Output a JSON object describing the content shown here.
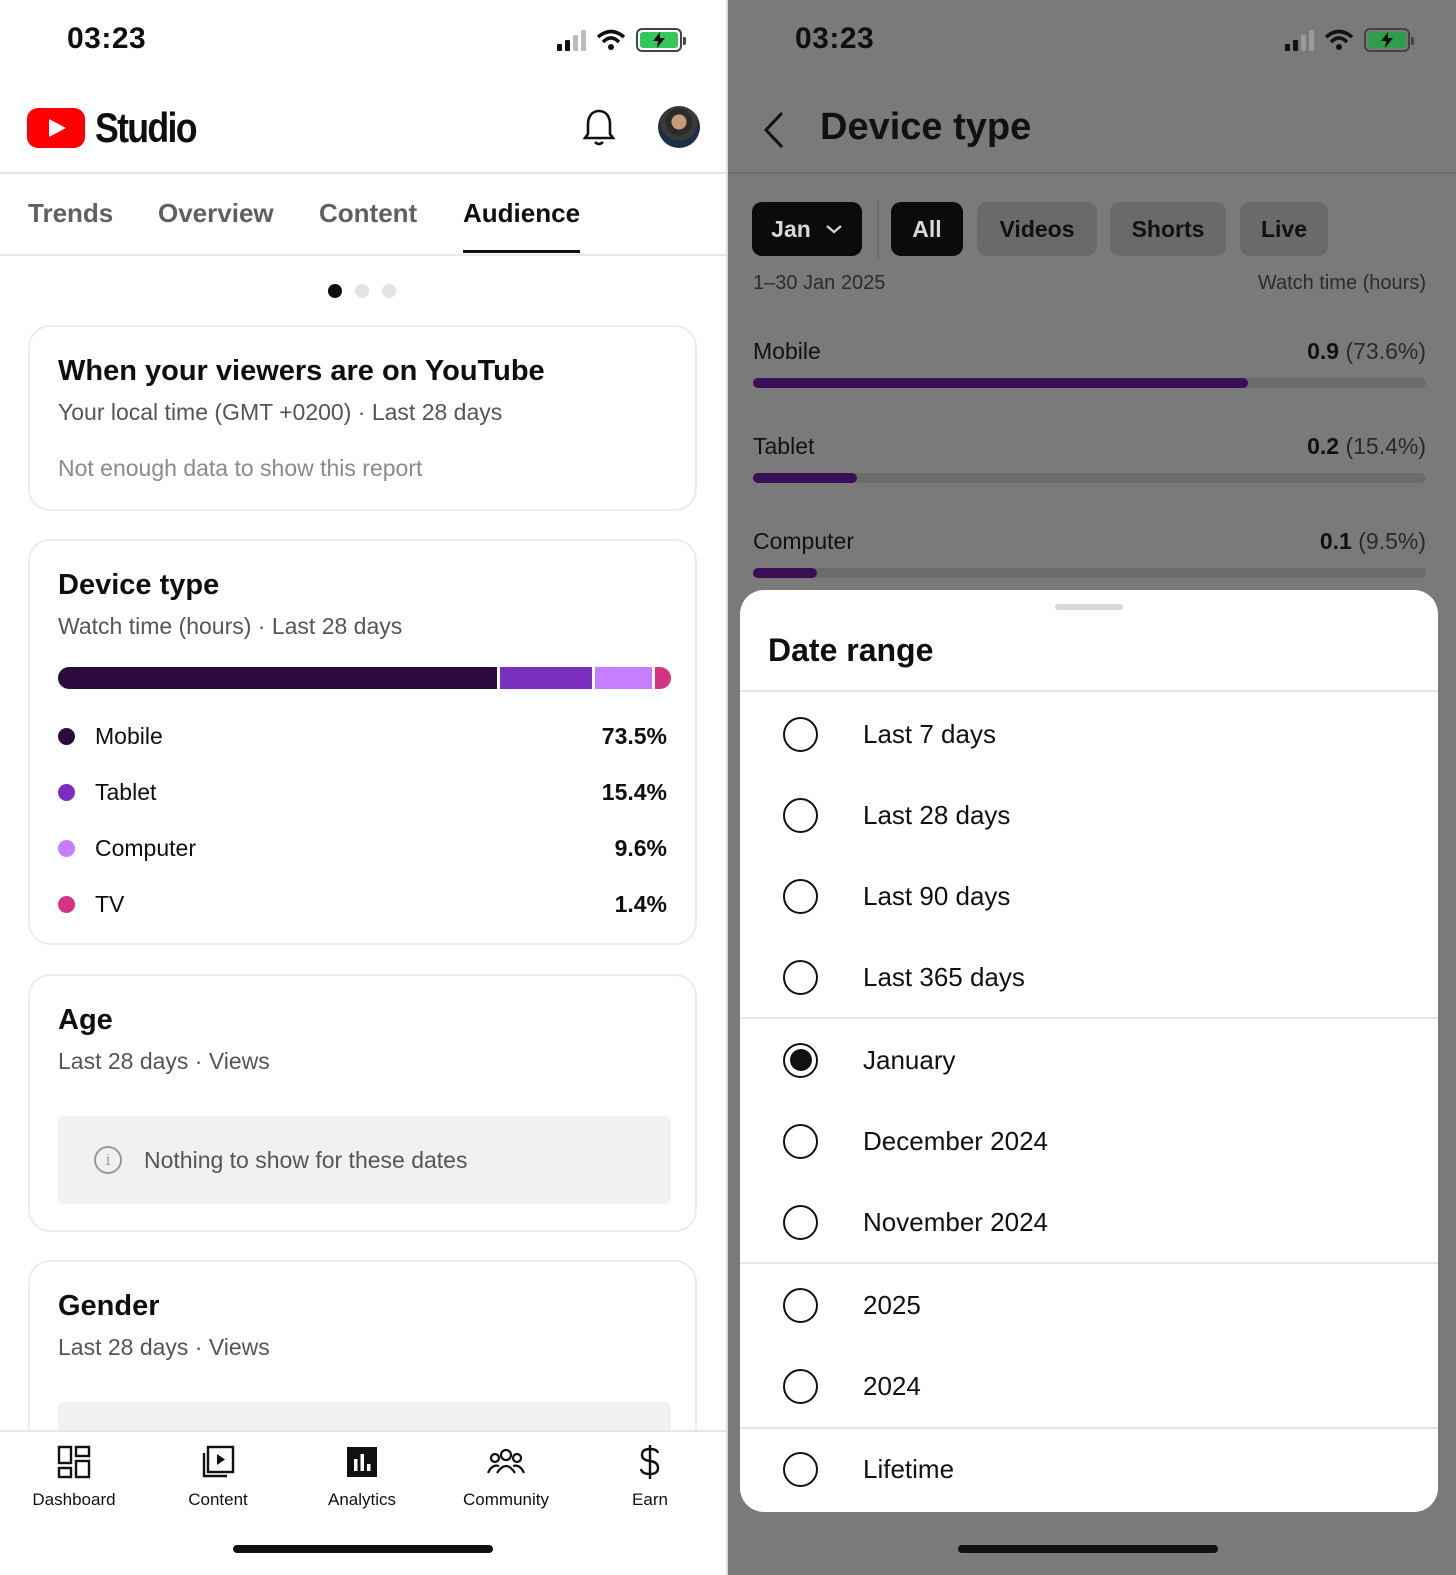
{
  "left": {
    "status": {
      "time": "03:23"
    },
    "logo_text": "Studio",
    "tabs": [
      "Trends",
      "Overview",
      "Content",
      "Audience"
    ],
    "active_tab": "Audience",
    "when_card": {
      "title": "When your viewers are on YouTube",
      "subtitle": "Your local time (GMT +0200) · Last 28 days",
      "empty": "Not enough data to show this report"
    },
    "device_card": {
      "title": "Device type",
      "subtitle": "Watch time (hours) · Last 28 days",
      "items": [
        {
          "label": "Mobile",
          "pct": "73.5%",
          "value": 73.5,
          "color": "#2b0a3d"
        },
        {
          "label": "Tablet",
          "pct": "15.4%",
          "value": 15.4,
          "color": "#7b2fbf"
        },
        {
          "label": "Computer",
          "pct": "9.6%",
          "value": 9.6,
          "color": "#c77dff"
        },
        {
          "label": "TV",
          "pct": "1.4%",
          "value": 1.4,
          "color": "#d63384"
        }
      ]
    },
    "age_card": {
      "title": "Age",
      "subtitle": "Last 28 days · Views",
      "empty": "Nothing to show for these dates"
    },
    "gender_card": {
      "title": "Gender",
      "subtitle": "Last 28 days · Views"
    },
    "bottom_nav": [
      "Dashboard",
      "Content",
      "Analytics",
      "Community",
      "Earn"
    ]
  },
  "right": {
    "status": {
      "time": "03:23"
    },
    "title": "Device type",
    "chips": {
      "month": "Jan",
      "all": "All",
      "videos": "Videos",
      "shorts": "Shorts",
      "live": "Live"
    },
    "range_label": "1–30 Jan 2025",
    "metric_label": "Watch time (hours)",
    "devices": [
      {
        "name": "Mobile",
        "value": "0.9",
        "pct": "(73.6%)",
        "fraction": 0.736
      },
      {
        "name": "Tablet",
        "value": "0.2",
        "pct": "(15.4%)",
        "fraction": 0.154
      },
      {
        "name": "Computer",
        "value": "0.1",
        "pct": "(9.5%)",
        "fraction": 0.095
      }
    ],
    "sheet": {
      "title": "Date range",
      "options": [
        "Last 7 days",
        "Last 28 days",
        "Last 90 days",
        "Last 365 days",
        "January",
        "December 2024",
        "November 2024",
        "2025",
        "2024",
        "Lifetime"
      ],
      "selected": "January"
    }
  },
  "colors": {
    "brand_red": "#ff0000",
    "battery_green": "#34c759",
    "bar_purple": "#3a0f55"
  }
}
